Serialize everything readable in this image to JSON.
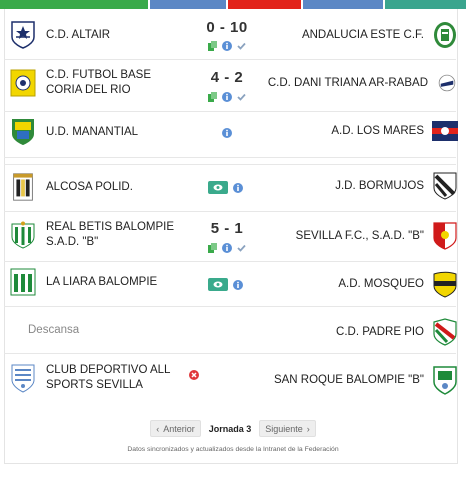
{
  "colors": {
    "green": "#3aaa4a",
    "blue": "#5b87c5",
    "red": "#e2231a",
    "teal": "#3aa58e",
    "accent_icon": "#5a8fd6",
    "check": "#8aa2bf",
    "error": "#e0373a"
  },
  "matches": [
    {
      "home": "C.D. ALTAIR",
      "away": "ANDALUCIA ESTE C.F.",
      "score": "0 - 10",
      "status": "finished"
    },
    {
      "home": "C.D. FUTBOL BASE CORIA DEL RIO",
      "away": "C.D. DANI TRIANA AR-RABAD",
      "score": "4 - 2",
      "status": "finished"
    },
    {
      "home": "U.D. MANANTIAL",
      "away": "A.D. LOS MARES",
      "score": "",
      "status": "info"
    },
    {
      "home": "ALCOSA POLID.",
      "away": "J.D. BORMUJOS",
      "score": "",
      "status": "live"
    },
    {
      "home": "REAL BETIS BALOMPIE S.A.D. \"B\"",
      "away": "SEVILLA F.C., S.A.D. \"B\"",
      "score": "5 - 1",
      "status": "finished"
    },
    {
      "home": "LA LIARA BALOMPIE",
      "away": "A.D. MOSQUEO",
      "score": "",
      "status": "live"
    },
    {
      "home": "Descansa",
      "away": "C.D. PADRE PIO",
      "score": "",
      "status": "rest"
    },
    {
      "home": "CLUB DEPORTIVO ALL SPORTS SEVILLA",
      "away": "SAN ROQUE BALOMPIE \"B\"",
      "score": "",
      "status": "cancelled"
    }
  ],
  "pagination": {
    "prev": "Anterior",
    "current": "Jornada 3",
    "next": "Siguiente"
  },
  "footer": "Datos sincronizados y actualizados desde la Intranet de la Federación"
}
